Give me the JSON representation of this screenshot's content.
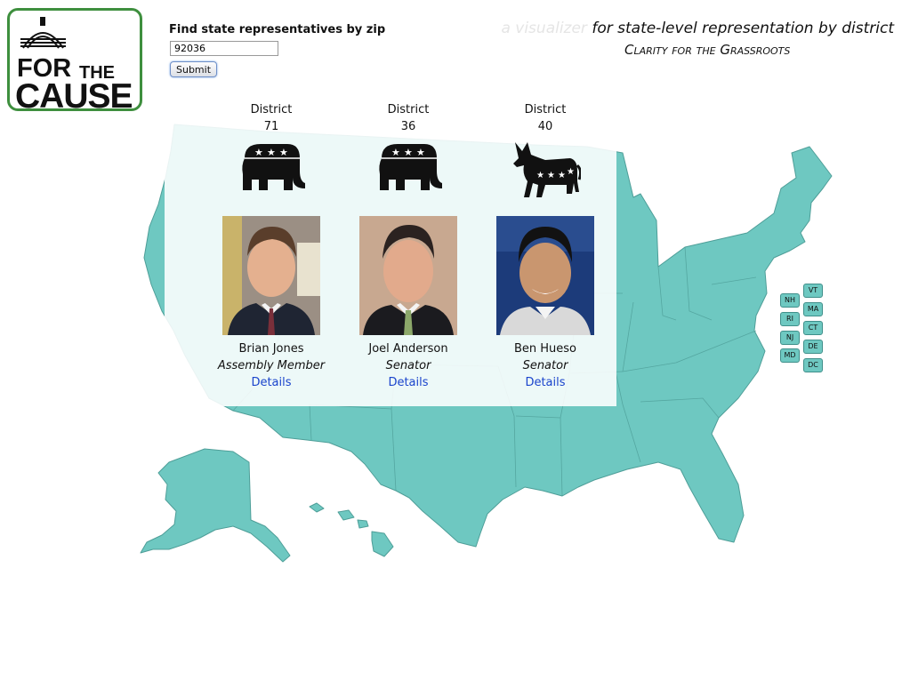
{
  "logo": {
    "line1": "FOR",
    "line1b": "THE",
    "line2": "CAUSE"
  },
  "search": {
    "label": "Find state representatives by zip",
    "zip_value": "92036",
    "submit_label": "Submit"
  },
  "header": {
    "tagline_faded": "a visualizer ",
    "tagline_main": "for state-level representation by district",
    "subtagline": "Clarity for the Grassroots"
  },
  "representatives": [
    {
      "district_label": "District",
      "district": "71",
      "party_icon": "republican-elephant-icon",
      "name": "Brian Jones",
      "role": "Assembly Member",
      "details_label": "Details"
    },
    {
      "district_label": "District",
      "district": "36",
      "party_icon": "republican-elephant-icon",
      "name": "Joel Anderson",
      "role": "Senator",
      "details_label": "Details"
    },
    {
      "district_label": "District",
      "district": "40",
      "party_icon": "democrat-donkey-icon",
      "name": "Ben Hueso",
      "role": "Senator",
      "details_label": "Details"
    }
  ],
  "small_states": [
    "VT",
    "NH",
    "MA",
    "RI",
    "CT",
    "NJ",
    "DE",
    "MD",
    "DC"
  ],
  "colors": {
    "map_fill": "#6ec8c1",
    "map_stroke": "#4e9e98",
    "logo_border": "#3e8f3e",
    "link": "#1a44cc"
  }
}
